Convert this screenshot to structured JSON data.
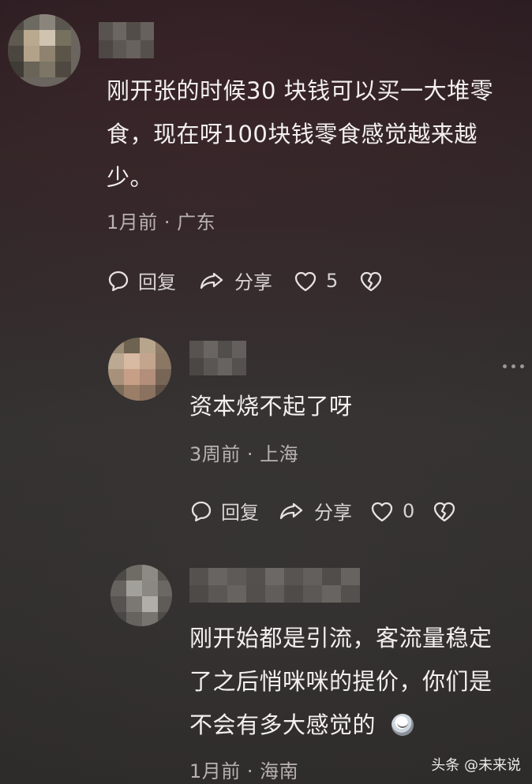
{
  "thread": {
    "main": {
      "text_lines": [
        "刚开张的时候30 块钱可以买一大堆零",
        "食，现在呀100块钱零食感觉越来越",
        "少。"
      ],
      "meta": "1月前 · 广东",
      "actions": {
        "reply": "回复",
        "share": "分享",
        "like_count": "5"
      }
    },
    "reply_1": {
      "text": "资本烧不起了呀",
      "meta": "3周前 · 上海",
      "actions": {
        "reply": "回复",
        "share": "分享",
        "like_count": "0"
      }
    },
    "reply_2": {
      "text_lines": [
        "刚开始都是引流，客流量稳定",
        "了之后悄咪咪的提价，你们是",
        "不会有多大感觉的"
      ],
      "meta": "1月前 · 海南"
    }
  },
  "watermark": "头条 @未来说",
  "icons": {
    "reply": "comment-bubble-icon",
    "share": "share-arrow-icon",
    "like": "heart-outline-icon",
    "dislike": "broken-heart-icon",
    "more": "more-dots-icon",
    "emoji": "cat-emoji-icon"
  }
}
